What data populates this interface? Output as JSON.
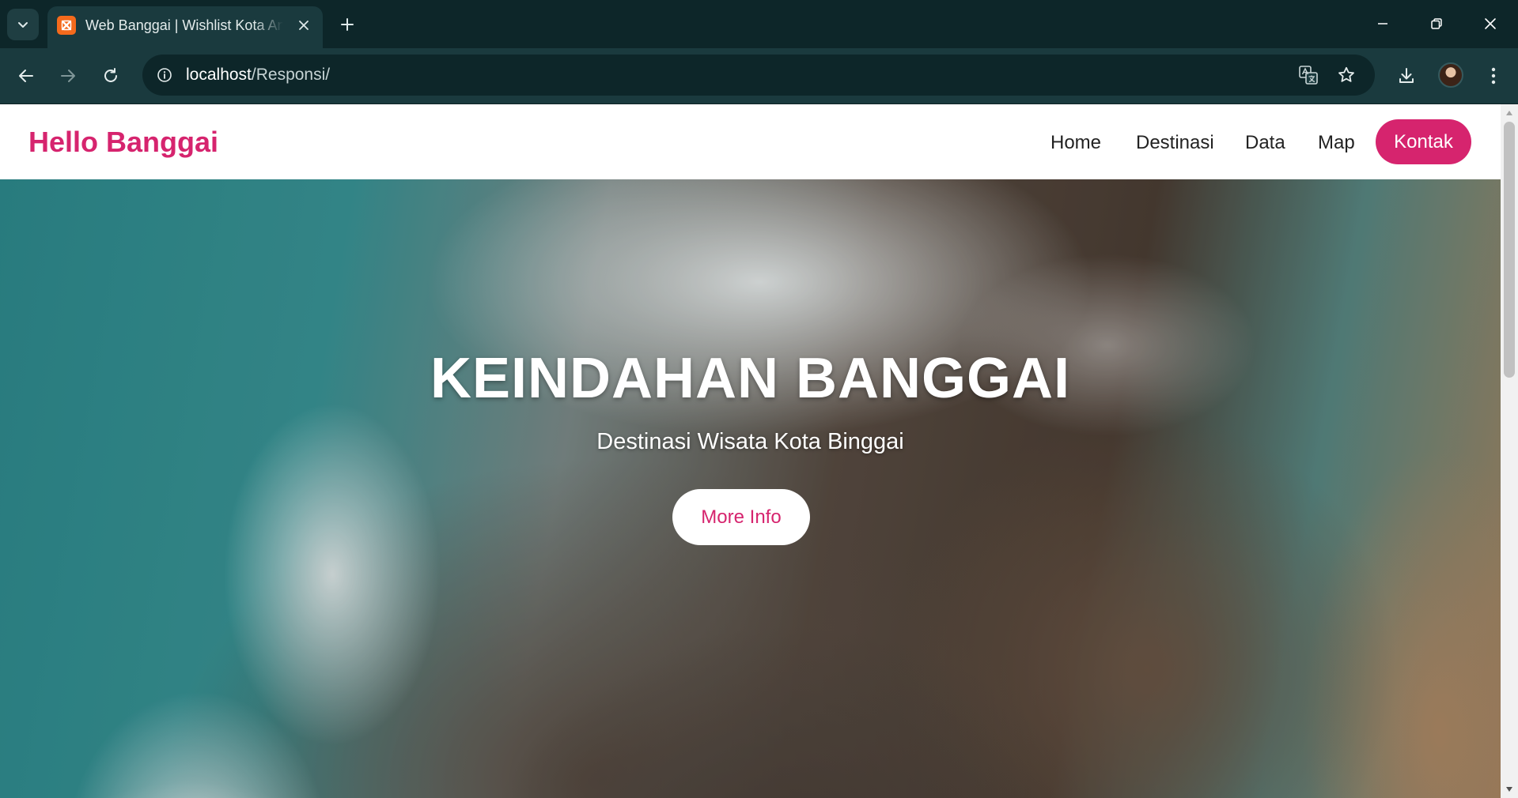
{
  "browser": {
    "tab": {
      "title": "Web Banggai | Wishlist Kota Animasi",
      "favicon": "xampp-icon"
    },
    "address": {
      "host": "localhost",
      "path": "/Responsi/"
    },
    "icons": {
      "tab_search": "chevron-down-icon",
      "tab_close": "close-icon",
      "new_tab": "plus-icon",
      "back": "back-arrow-icon",
      "forward": "forward-arrow-icon",
      "reload": "reload-icon",
      "site_info": "info-icon",
      "translate": "translate-icon",
      "bookmark": "star-icon",
      "download": "download-icon",
      "profile": "avatar",
      "menu": "kebab-menu-icon",
      "minimize": "minimize-icon",
      "restore": "restore-icon",
      "close_window": "close-icon"
    }
  },
  "page": {
    "brand": "Hello Banggai",
    "nav": [
      "Home",
      "Destinasi",
      "Data",
      "Map"
    ],
    "nav_cta": "Kontak",
    "hero": {
      "title": "KEINDAHAN BANGGAI",
      "subtitle": "Destinasi Wisata Kota Binggai",
      "button": "More Info"
    }
  },
  "colors": {
    "accent": "#d6246e",
    "chrome_dark": "#0d2629",
    "chrome_toolbar": "#1a3a3e",
    "page_bg": "#ffffff"
  }
}
